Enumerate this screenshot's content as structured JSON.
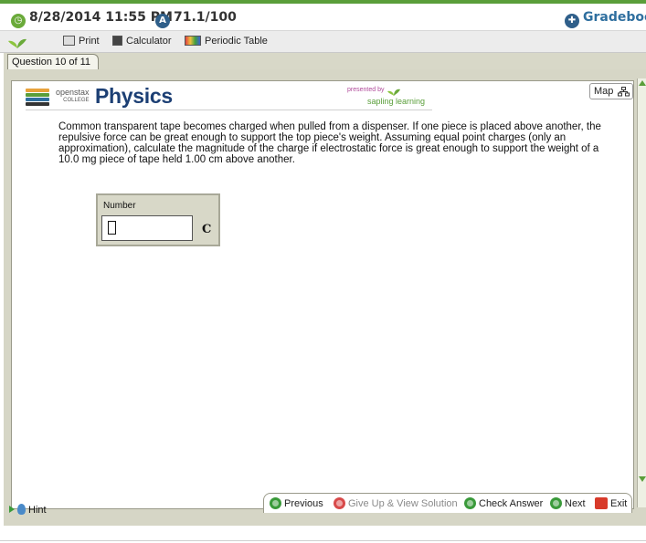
{
  "status": {
    "date_time": "8/28/2014 11:55 PM",
    "score": "71.1/100",
    "gradebook_label": "Gradebook"
  },
  "toolbar": {
    "print_label": "Print",
    "calculator_label": "Calculator",
    "periodic_table_label": "Periodic Table"
  },
  "tab": {
    "label": "Question 10 of 11"
  },
  "header": {
    "publisher": "openstax",
    "publisher_sub": "COLLEGE",
    "subject": "Physics",
    "presented_by": "presented by",
    "partner": "sapling learning",
    "map_label": "Map"
  },
  "question": {
    "text": "Common transparent tape becomes charged when pulled from a dispenser. If one piece is placed above another, the repulsive force can be great enough to support the top piece's weight. Assuming equal point charges (only an approximation), calculate the magnitude of the charge if electrostatic force is great enough to support the weight of a 10.0 mg piece of tape held 1.00 cm above another."
  },
  "answer": {
    "label": "Number",
    "value": "",
    "unit": "C"
  },
  "nav": {
    "previous": "Previous",
    "give_up": "Give Up & View Solution",
    "check_answer": "Check Answer",
    "next": "Next",
    "exit": "Exit"
  },
  "hint": {
    "label": "Hint"
  },
  "colors": {
    "accent_green": "#5a9e3a",
    "brand_blue": "#1c3f74",
    "frame": "#d6d6c6"
  }
}
